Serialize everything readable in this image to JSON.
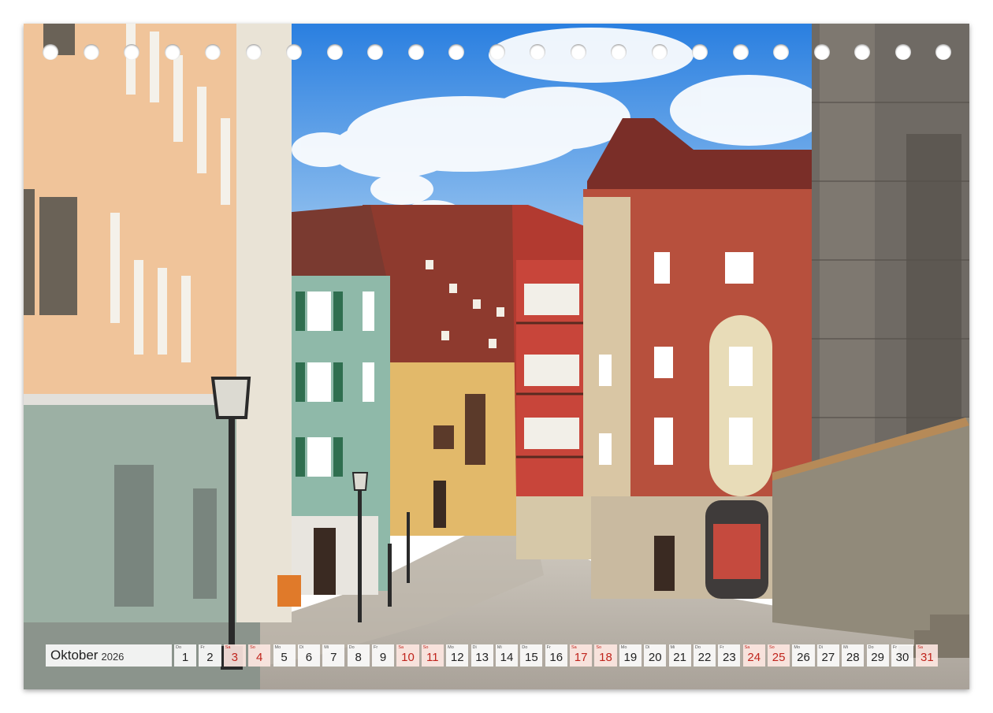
{
  "calendar": {
    "month": "Oktober",
    "year": "2026",
    "weekend_color": "#c0241c",
    "days": [
      {
        "n": "1",
        "wd": "Do",
        "weekend": false
      },
      {
        "n": "2",
        "wd": "Fr",
        "weekend": false
      },
      {
        "n": "3",
        "wd": "Sa",
        "weekend": true
      },
      {
        "n": "4",
        "wd": "So",
        "weekend": true
      },
      {
        "n": "5",
        "wd": "Mo",
        "weekend": false
      },
      {
        "n": "6",
        "wd": "Di",
        "weekend": false
      },
      {
        "n": "7",
        "wd": "Mi",
        "weekend": false
      },
      {
        "n": "8",
        "wd": "Do",
        "weekend": false
      },
      {
        "n": "9",
        "wd": "Fr",
        "weekend": false
      },
      {
        "n": "10",
        "wd": "Sa",
        "weekend": true
      },
      {
        "n": "11",
        "wd": "So",
        "weekend": true
      },
      {
        "n": "12",
        "wd": "Mo",
        "weekend": false
      },
      {
        "n": "13",
        "wd": "Di",
        "weekend": false
      },
      {
        "n": "14",
        "wd": "Mi",
        "weekend": false
      },
      {
        "n": "15",
        "wd": "Do",
        "weekend": false
      },
      {
        "n": "16",
        "wd": "Fr",
        "weekend": false
      },
      {
        "n": "17",
        "wd": "Sa",
        "weekend": true
      },
      {
        "n": "18",
        "wd": "So",
        "weekend": true
      },
      {
        "n": "19",
        "wd": "Mo",
        "weekend": false
      },
      {
        "n": "20",
        "wd": "Di",
        "weekend": false
      },
      {
        "n": "21",
        "wd": "Mi",
        "weekend": false
      },
      {
        "n": "22",
        "wd": "Do",
        "weekend": false
      },
      {
        "n": "23",
        "wd": "Fr",
        "weekend": false
      },
      {
        "n": "24",
        "wd": "Sa",
        "weekend": true
      },
      {
        "n": "25",
        "wd": "So",
        "weekend": true
      },
      {
        "n": "26",
        "wd": "Mo",
        "weekend": false
      },
      {
        "n": "27",
        "wd": "Di",
        "weekend": false
      },
      {
        "n": "28",
        "wd": "Mi",
        "weekend": false
      },
      {
        "n": "29",
        "wd": "Do",
        "weekend": false
      },
      {
        "n": "30",
        "wd": "Fr",
        "weekend": false
      },
      {
        "n": "31",
        "wd": "Sa",
        "weekend": true
      }
    ]
  },
  "binding_hole_count": 23
}
